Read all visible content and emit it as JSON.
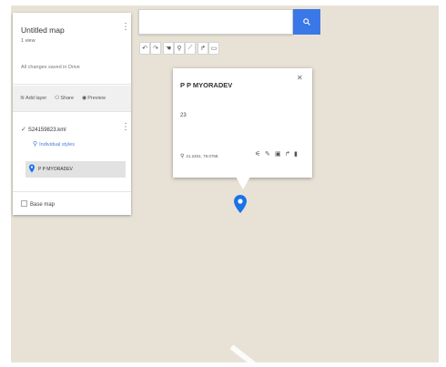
{
  "map": {
    "title": "Untitled map",
    "views": "1 view",
    "saved_status": "All changes saved in Drive",
    "actions": {
      "add_layer": "Add layer",
      "share": "Share",
      "preview": "Preview"
    },
    "layer": {
      "name": "S24159823.kml",
      "styles_link": "Individual styles",
      "selected_item": "P P MYORADEV"
    },
    "base_map": "Base map"
  },
  "search": {
    "value": "",
    "placeholder": ""
  },
  "popup": {
    "title": "P P MYORADEV",
    "description": "23",
    "coordinates": "21.2401, 79.0768"
  },
  "colors": {
    "accent": "#3b78e7",
    "marker": "#1a73e8",
    "map_bg": "#e8e2d6"
  },
  "icons": {
    "search": "search-icon",
    "pin": "pin-icon",
    "more": "more-vert-icon",
    "close": "close-icon"
  }
}
